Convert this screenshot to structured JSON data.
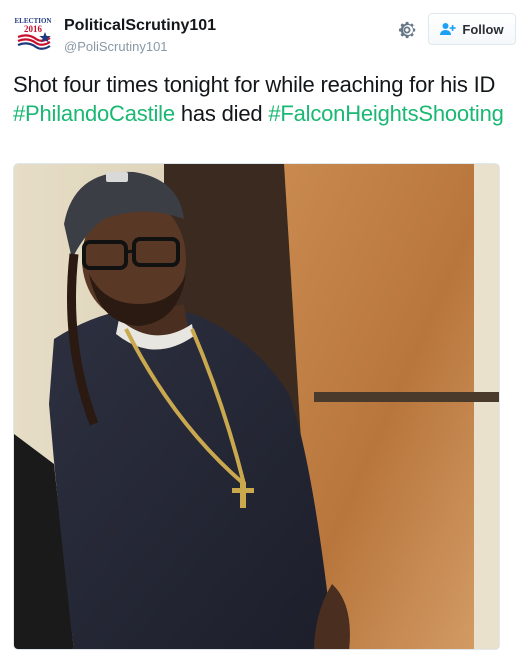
{
  "user": {
    "full_name": "PoliticalScrutiny101",
    "username": "@PoliScrutiny101",
    "avatar_text_top": "ELECTION",
    "avatar_text_year": "2016"
  },
  "actions": {
    "follow_label": "Follow",
    "settings_icon": "gear-icon",
    "follow_icon": "add-user-icon"
  },
  "tweet": {
    "text_part1": "Shot four times tonight for while reaching for his ID ",
    "hashtag1": "#PhilandoCastile",
    "text_part2": " has died ",
    "hashtag2": "#FalconHeightsShooting"
  },
  "media": {
    "type": "photo"
  },
  "colors": {
    "hashtag": "#1ab873",
    "username": "#8899a6",
    "text": "#14171a",
    "follow_icon": "#1da1f2"
  }
}
